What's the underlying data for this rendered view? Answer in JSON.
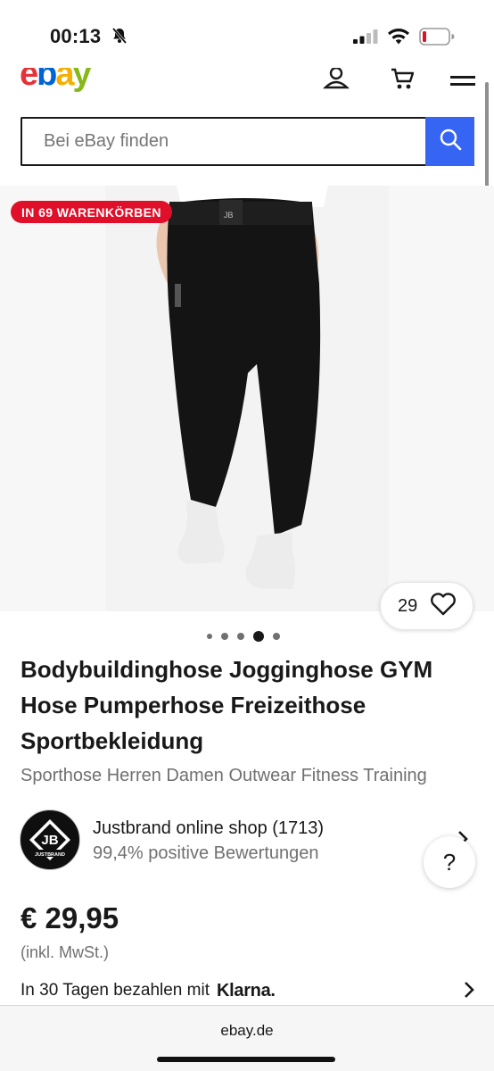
{
  "status_bar": {
    "time": "00:13"
  },
  "header": {
    "logo": {
      "e": "e",
      "b": "b",
      "a": "a",
      "y": "y"
    }
  },
  "search": {
    "placeholder": "Bei eBay finden"
  },
  "gallery": {
    "badge": "IN 69 WARENKÖRBEN",
    "watch_count": "29",
    "image_count": 5,
    "active_image": 4
  },
  "listing": {
    "title": "Bodybuildinghose Jogginghose GYM Hose Pumperhose Freizeithose Sportbekleidung",
    "subtitle": "Sporthose Herren Damen Outwear Fitness Training"
  },
  "seller": {
    "name": "Justbrand online shop (1713)",
    "rating": "99,4% positive Bewertungen",
    "avatar_text": "JB",
    "avatar_subtext": "JUSTBRAND"
  },
  "help": {
    "label": "?"
  },
  "price": {
    "amount": "€ 29,95",
    "vat": "(inkl. MwSt.)"
  },
  "klarna": {
    "text": "In 30 Tagen bezahlen mit",
    "brand": "Klarna."
  },
  "browser": {
    "url": "ebay.de"
  },
  "colors": {
    "brand_blue": "#3665f3",
    "badge_red": "#e0102a",
    "text_primary": "#191919",
    "text_secondary": "#707070"
  }
}
